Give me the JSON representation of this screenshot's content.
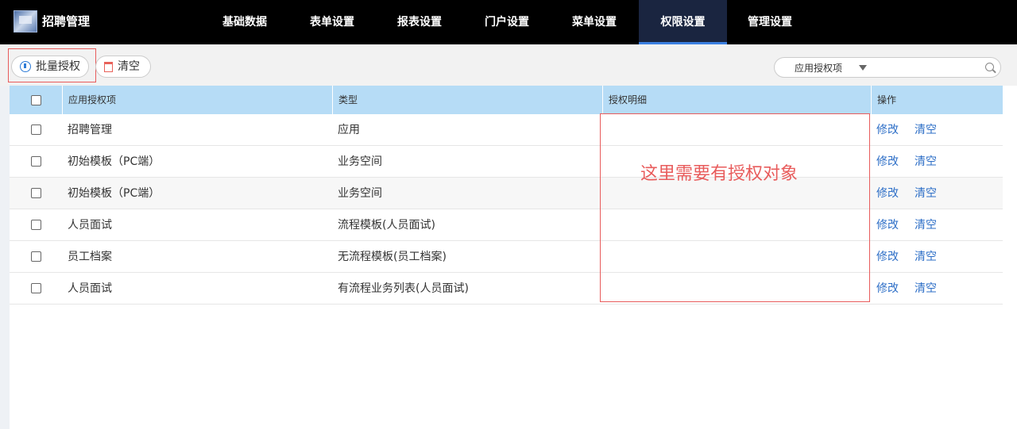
{
  "header": {
    "app_title": "招聘管理",
    "nav": [
      {
        "label": "基础数据"
      },
      {
        "label": "表单设置"
      },
      {
        "label": "报表设置"
      },
      {
        "label": "门户设置"
      },
      {
        "label": "菜单设置"
      },
      {
        "label": "权限设置",
        "active": true
      },
      {
        "label": "管理设置"
      }
    ]
  },
  "toolbar": {
    "batch_authorize_label": "批量授权",
    "clear_label": "清空",
    "search": {
      "selected_option": "应用授权项",
      "value": ""
    }
  },
  "table": {
    "columns": [
      "应用授权项",
      "类型",
      "授权明细",
      "操作"
    ],
    "rows": [
      {
        "item": "招聘管理",
        "type": "应用",
        "detail": ""
      },
      {
        "item": "初始模板（PC端）",
        "type": "业务空间",
        "detail": ""
      },
      {
        "item": "初始模板（PC端）",
        "type": "业务空间",
        "detail": ""
      },
      {
        "item": "人员面试",
        "type": "流程模板(人员面试)",
        "detail": ""
      },
      {
        "item": "员工档案",
        "type": "无流程模板(员工档案)",
        "detail": ""
      },
      {
        "item": "人员面试",
        "type": "有流程业务列表(人员面试)",
        "detail": ""
      }
    ],
    "actions": {
      "edit": "修改",
      "clear": "清空"
    }
  },
  "annotation": {
    "text": "这里需要有授权对象"
  },
  "colors": {
    "header_bg": "#000000",
    "active_nav_bg": "#1a2540",
    "table_header_bg": "#b6dcf6",
    "link": "#2e6fc7",
    "annotation": "#e85c5c"
  }
}
